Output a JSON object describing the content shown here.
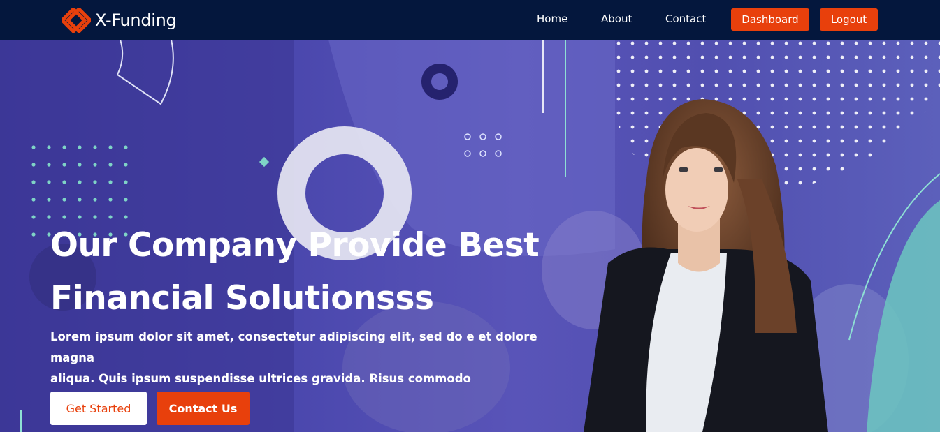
{
  "brand": {
    "name": "X-Funding"
  },
  "nav": {
    "home": "Home",
    "about": "About",
    "contact": "Contact",
    "dashboard": "Dashboard",
    "logout": "Logout"
  },
  "hero": {
    "title_line1": "Our Company Provide Best",
    "title_line2": "Financial Solutionsss",
    "text_line1": "Lorem ipsum dolor sit amet, consectetur adipiscing elit, sed do e et dolore magna",
    "text_line2": "aliqua. Quis ipsum suspendisse ultrices gravida. Risus commodo",
    "get_started": "Get Started",
    "contact_us": "Contact Us"
  },
  "colors": {
    "navbar_bg": "#04173d",
    "accent": "#e8400c",
    "hero_bg": "#4a47ad",
    "teal": "#6cc7bf"
  },
  "icons": [
    "x-funding-logo-icon"
  ]
}
